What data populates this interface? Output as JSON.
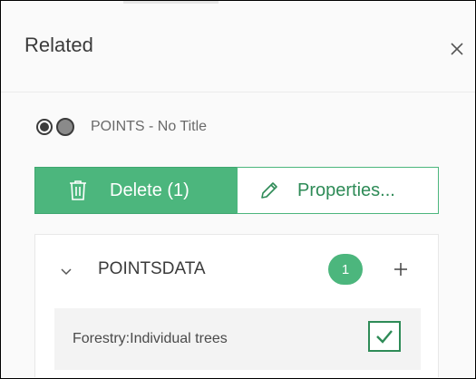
{
  "header": {
    "title": "Related",
    "close_icon": "close-icon"
  },
  "layer": {
    "label": "POINTS - No Title",
    "icons": [
      "radio-selected-icon",
      "layer-color-icon"
    ]
  },
  "actions": {
    "delete": {
      "label": "Delete (1)",
      "icon": "trash-icon"
    },
    "properties": {
      "label": "Properties...",
      "icon": "pencil-icon"
    }
  },
  "related_table": {
    "title": "POINTSDATA",
    "count": "1",
    "records": [
      {
        "label": "Forestry:Individual trees",
        "checked": true
      }
    ]
  },
  "colors": {
    "accent": "#4cb67d",
    "accent_dark": "#2e8b57",
    "text": "#3b3b3b"
  }
}
